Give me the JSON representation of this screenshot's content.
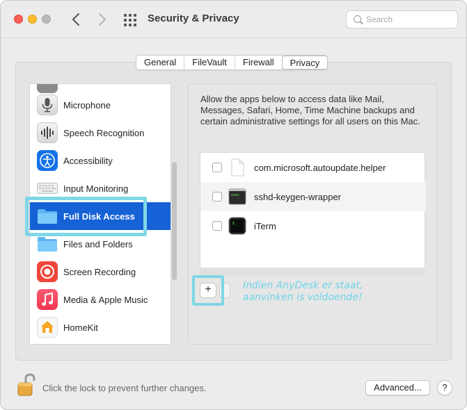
{
  "window": {
    "title": "Security & Privacy",
    "search_placeholder": "Search"
  },
  "tabs": [
    {
      "label": "General",
      "active": false
    },
    {
      "label": "FileVault",
      "active": false
    },
    {
      "label": "Firewall",
      "active": false
    },
    {
      "label": "Privacy",
      "active": true
    }
  ],
  "sidebar": {
    "items": [
      {
        "label": "Microphone",
        "icon": "microphone-icon"
      },
      {
        "label": "Speech Recognition",
        "icon": "waveform-icon"
      },
      {
        "label": "Accessibility",
        "icon": "accessibility-icon"
      },
      {
        "label": "Input Monitoring",
        "icon": "keyboard-icon"
      },
      {
        "label": "Full Disk Access",
        "icon": "folder-icon",
        "selected": true
      },
      {
        "label": "Files and Folders",
        "icon": "folder-icon"
      },
      {
        "label": "Screen Recording",
        "icon": "record-icon"
      },
      {
        "label": "Media & Apple Music",
        "icon": "music-note-icon"
      },
      {
        "label": "HomeKit",
        "icon": "home-icon"
      }
    ]
  },
  "detail": {
    "description": "Allow the apps below to access data like Mail, Messages, Safari, Home, Time Machine backups and certain administrative settings for all users on this Mac.",
    "apps": [
      {
        "label": "com.microsoft.autoupdate.helper",
        "icon": "document-icon",
        "checked": false
      },
      {
        "label": "sshd-keygen-wrapper",
        "icon": "terminal-icon",
        "checked": false
      },
      {
        "label": "iTerm",
        "icon": "iterm-icon",
        "checked": false
      }
    ],
    "add_label": "+"
  },
  "annotation": {
    "line1": "Indien AnyDesk er staat,",
    "line2": "aanvinken is voldoende!"
  },
  "footer": {
    "lock_text": "Click the lock to prevent further changes.",
    "advanced_label": "Advanced...",
    "help_label": "?"
  },
  "colors": {
    "selection": "#1561d6",
    "highlight": "#7fd7e6",
    "annotation": "#6fd3e8"
  }
}
